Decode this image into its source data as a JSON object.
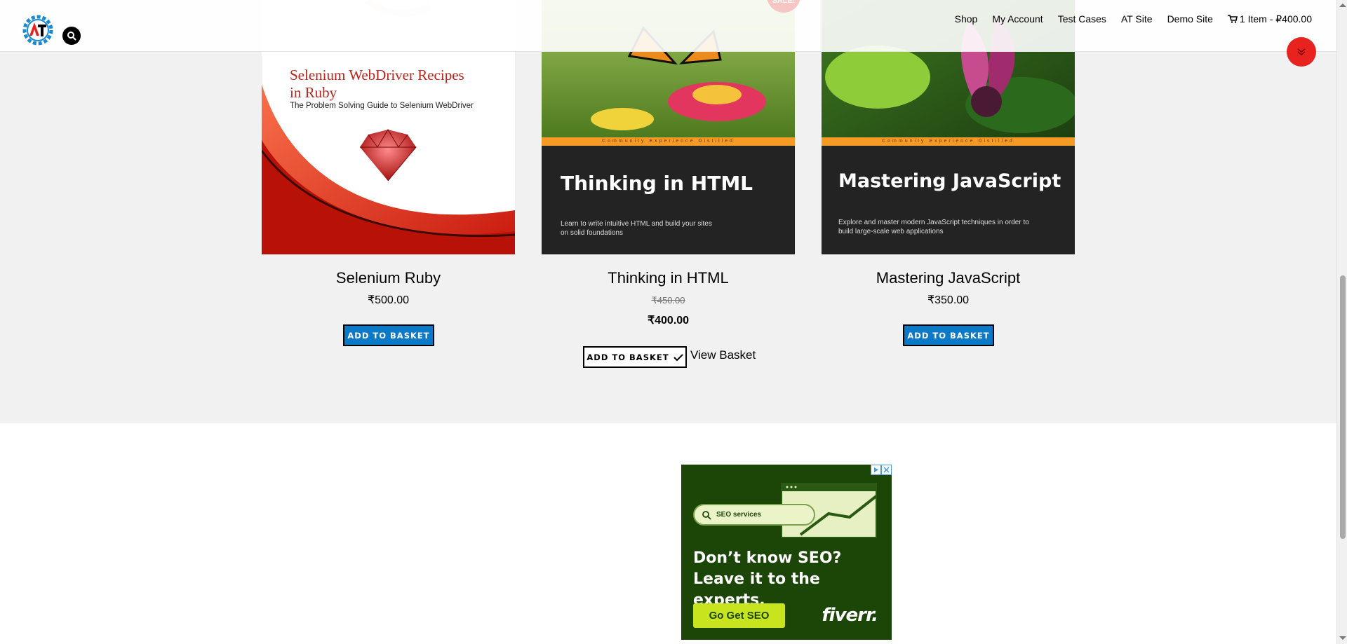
{
  "header": {
    "logo_alt": "AT logo",
    "nav": [
      "Shop",
      "My Account",
      "Test Cases",
      "AT Site",
      "Demo Site"
    ],
    "cart_label": "1 Item - ₽400.00",
    "icons": {
      "search": "search-icon",
      "cart": "cart-icon",
      "scroll_top": "chevron-double-down-icon"
    }
  },
  "products": [
    {
      "title": "Selenium Ruby",
      "price": "₹500.00",
      "button": "ADD TO BASKET",
      "cover": {
        "heading_line1": "Selenium WebDriver Recipes",
        "heading_line2": "in Ruby",
        "subtitle": "The Problem Solving Guide to Selenium WebDriver"
      }
    },
    {
      "title": "Thinking in HTML",
      "old_price": "₹450.00",
      "price": "₹400.00",
      "button": "ADD TO BASKET",
      "view_basket": "View Basket",
      "sale_badge": "SALE!",
      "cover": {
        "band_text": "Community Experience Distilled",
        "heading": "Thinking in HTML",
        "tagline_line1": "Learn to write intuitive HTML and build your sites",
        "tagline_line2": "on solid foundations"
      }
    },
    {
      "title": "Mastering JavaScript",
      "price": "₹350.00",
      "button": "ADD TO BASKET",
      "cover": {
        "band_text": "Community Experience Distilled",
        "heading": "Mastering JavaScript",
        "tagline_line1": "Explore and master modern JavaScript techniques in order to",
        "tagline_line2": "build large-scale web applications"
      }
    }
  ],
  "ad": {
    "search_text": "SEO services",
    "headline_line1": "Don’t know SEO?",
    "headline_line2": "Leave it to the experts.",
    "cta": "Go Get SEO",
    "brand": "fiverr.",
    "colors": {
      "background": "#1c4508",
      "cta": "#c7e41e"
    }
  },
  "colors": {
    "button": "#0a79c8",
    "band": "#f1f1f1",
    "scroll_top": "#e8231f"
  }
}
